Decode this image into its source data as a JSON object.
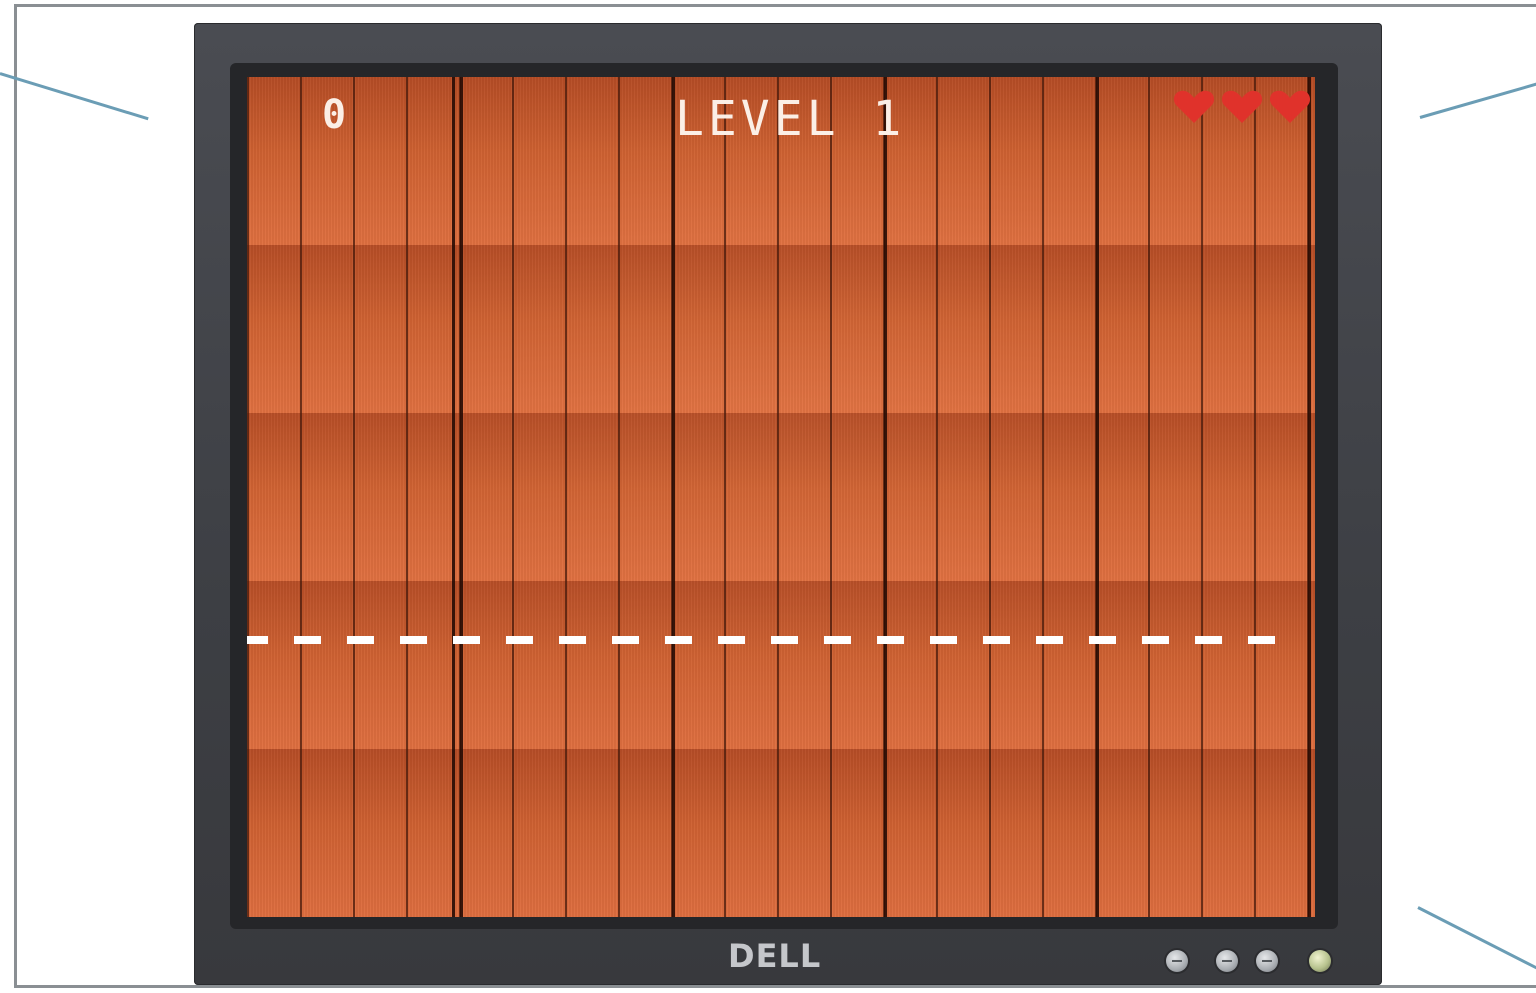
{
  "hud": {
    "score": "0",
    "level_text": "LEVEL 1",
    "lives": 3,
    "heart_color": "#e0322b"
  },
  "monitor": {
    "brand_logo": "DELL"
  },
  "controls": [
    {
      "name": "menu-button-icon"
    },
    {
      "name": "minus-button-icon"
    },
    {
      "name": "plus-button-icon"
    },
    {
      "name": "power-button-icon"
    }
  ],
  "colors": {
    "wood": "#d2622f",
    "dash_line": "#ffffff",
    "bezel": "#3f4146"
  }
}
